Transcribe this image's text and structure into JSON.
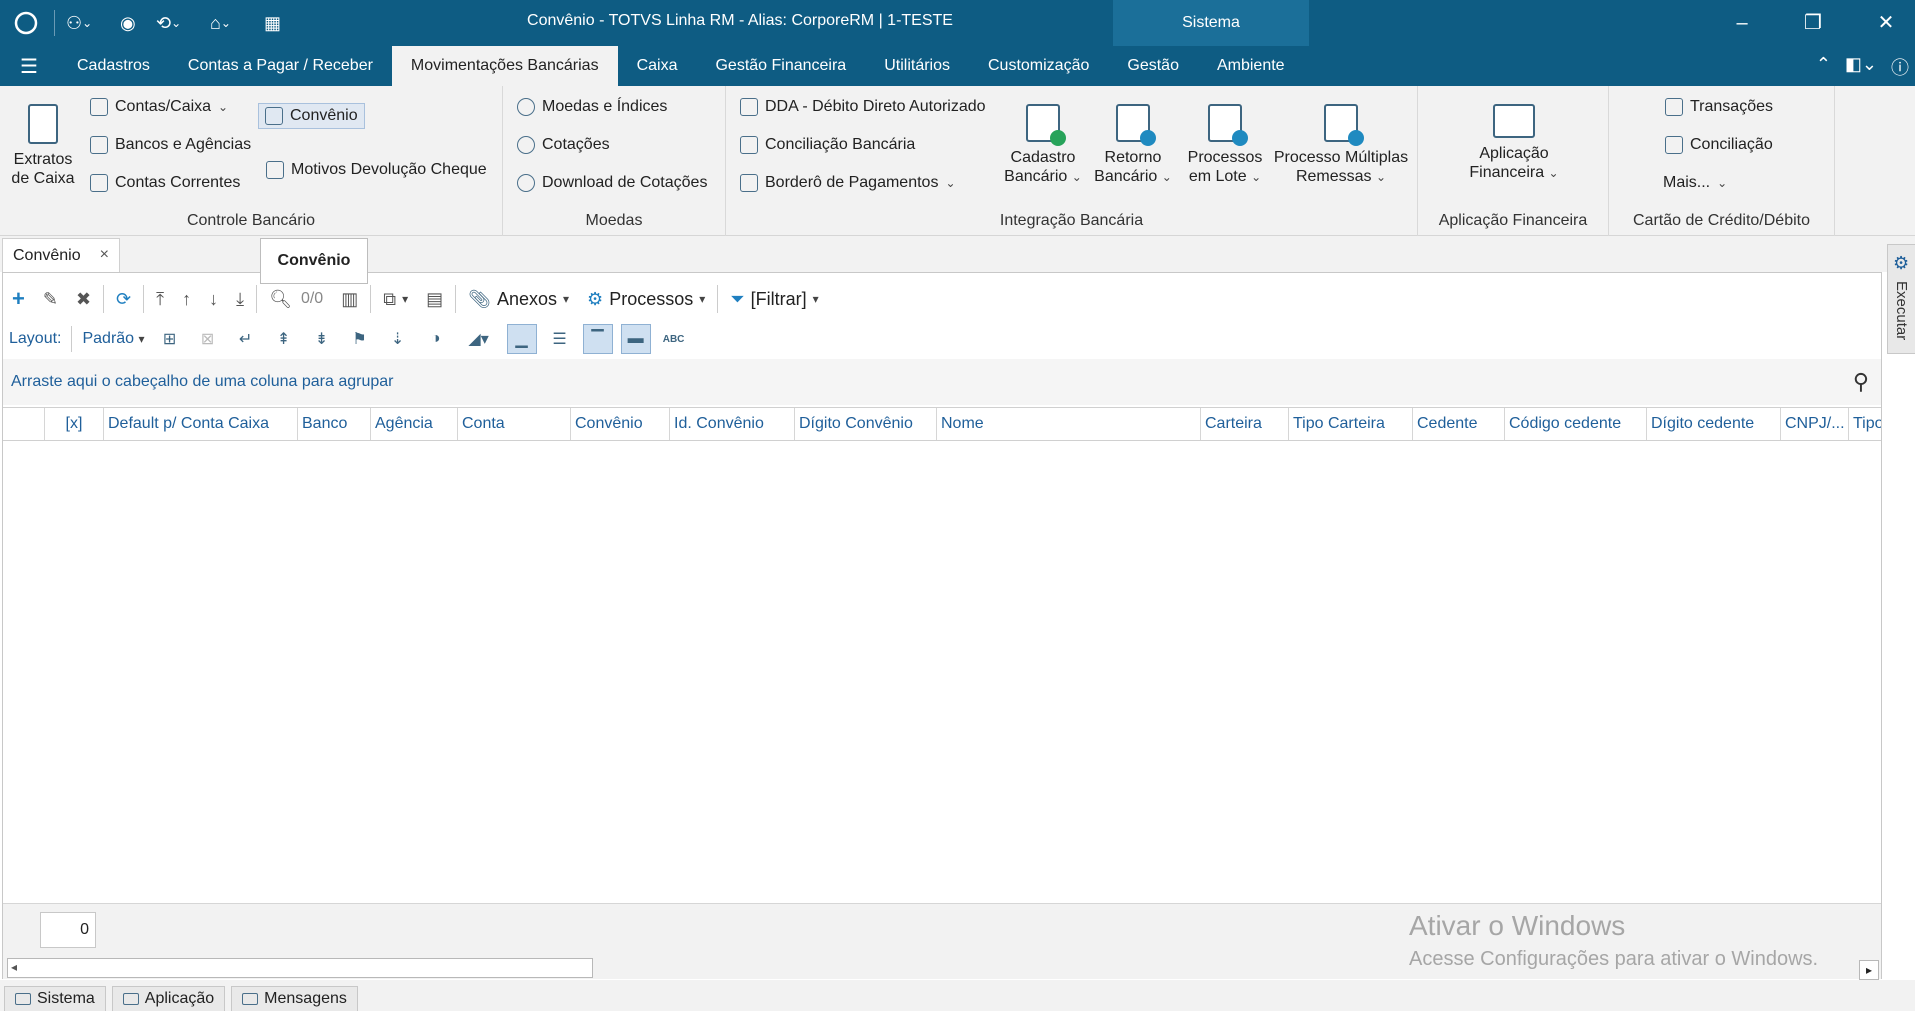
{
  "window": {
    "title": "Convênio - TOTVS Linha RM -  Alias: CorporeRM | 1-TESTE",
    "sistema_tab": "Sistema",
    "controls": [
      "minimize-icon",
      "restore-icon",
      "close-icon"
    ]
  },
  "menubar": {
    "items": [
      "Cadastros",
      "Contas a Pagar / Receber",
      "Movimentações Bancárias",
      "Caixa",
      "Gestão Financeira",
      "Utilitários",
      "Customização",
      "Gestão",
      "Ambiente"
    ],
    "active": "Movimentações Bancárias"
  },
  "ribbon": {
    "controle_bancario": {
      "caption": "Controle Bancário",
      "extratos": "Extratos de Caixa",
      "contas_caixa": "Contas/Caixa",
      "bancos_agencias": "Bancos e Agências",
      "contas_correntes": "Contas Correntes",
      "convenio": "Convênio",
      "motivos_devolucao": "Motivos Devolução Cheque"
    },
    "moedas": {
      "caption": "Moedas",
      "moedas_indices": "Moedas e Índices",
      "cotacoes": "Cotações",
      "download_cotacoes": "Download de Cotações"
    },
    "integracao": {
      "caption": "Integração Bancária",
      "dda": "DDA - Débito Direto Autorizado",
      "conciliacao": "Conciliação Bancária",
      "bordero": "Borderô de Pagamentos",
      "cadastro_bancario_1": "Cadastro",
      "cadastro_bancario_2": "Bancário",
      "retorno_bancario_1": "Retorno",
      "retorno_bancario_2": "Bancário",
      "processos_lote_1": "Processos",
      "processos_lote_2": "em Lote",
      "processo_multiplas_1": "Processo Múltiplas",
      "processo_multiplas_2": "Remessas"
    },
    "aplicacao": {
      "caption": "Aplicação Financeira",
      "label_1": "Aplicação",
      "label_2": "Financeira"
    },
    "cartao": {
      "caption": "Cartão de Crédito/Débito",
      "transacoes": "Transações",
      "conciliacao": "Conciliação",
      "mais": "Mais..."
    }
  },
  "doc_tab": {
    "label": "Convênio",
    "close": "×"
  },
  "tooltip": "Convênio",
  "toolbar": {
    "record_counter": "0/0",
    "anexos": "Anexos",
    "processos": "Processos",
    "filtrar": "[Filtrar]",
    "layout_label": "Layout:",
    "layout_value": "Padrão"
  },
  "grid": {
    "group_hint": "Arraste aqui o cabeçalho de uma coluna para agrupar",
    "columns": [
      "[x]",
      "Default p/ Conta Caixa",
      "Banco",
      "Agência",
      "Conta",
      "Convênio",
      "Id. Convênio",
      "Dígito Convênio",
      "Nome",
      "Carteira",
      "Tipo Carteira",
      "Cedente",
      "Código cedente",
      "Dígito cedente",
      "CNPJ/...",
      "Tipo"
    ],
    "rows": [],
    "record_count": "0"
  },
  "watermark": {
    "line1": "Ativar o Windows",
    "line2": "Acesse Configurações para ativar o Windows."
  },
  "side_panel": {
    "label": "Executar"
  },
  "statusbar": {
    "tabs": [
      "Sistema",
      "Aplicação",
      "Mensagens"
    ]
  },
  "colors": {
    "titlebar": "#0e5c83",
    "accent_text": "#1f5f9a",
    "ribbon_bg": "#f2f2f2"
  }
}
